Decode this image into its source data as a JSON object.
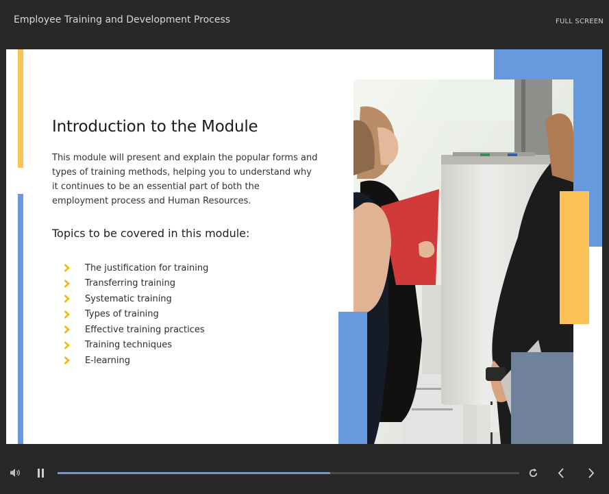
{
  "header": {
    "title": "Employee Training and Development Process",
    "fullscreen_label": "FULL SCREEN"
  },
  "slide": {
    "heading": "Introduction to the Module",
    "intro_lines": [
      "This module will present and explain the popular forms and",
      "types of training methods, helping you to understand why",
      "it continues to be an essential part of both the",
      "employment process and Human Resources."
    ],
    "subheading": "Topics to be covered in this module:",
    "topics": [
      "The justification for training",
      "Transferring training",
      "Systematic training",
      "Types of training",
      "Effective training practices",
      "Training techniques",
      "E-learning"
    ]
  },
  "player": {
    "progress": 0.59
  },
  "colors": {
    "accent_blue": "#6699dd",
    "accent_yellow": "#fcc257",
    "chevron": "#f5b800",
    "background": "#282828"
  },
  "icons": [
    "volume-icon",
    "pause-icon",
    "replay-icon",
    "previous-icon",
    "next-icon",
    "chevron-right-icon"
  ]
}
